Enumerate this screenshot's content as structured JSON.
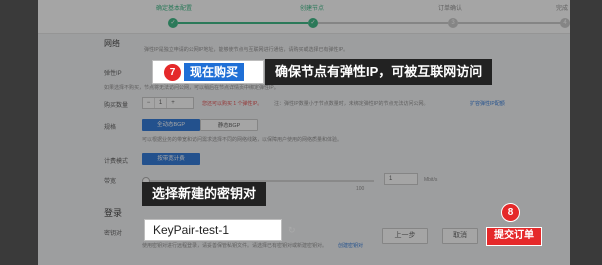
{
  "stepper": {
    "steps": [
      {
        "label": "确定基本配置",
        "state": "done"
      },
      {
        "label": "创建节点",
        "state": "done"
      },
      {
        "label": "订单确认",
        "state": "pending",
        "num": "3"
      },
      {
        "label": "完成",
        "state": "pending",
        "num": "4"
      }
    ]
  },
  "form": {
    "network_label": "网络",
    "network_hint": "弹性IP是独立申请的公网IP地址，能够使节点与互联网进行通信，请购买或选择已有弹性IP。",
    "eip_label": "弹性IP",
    "eip_hint": "如果选择不购买，节点将无法访问公网，可以稍后在节点详情页中绑定弹性IP。",
    "buy_count_label": "购买数量",
    "buy_count_value": "1",
    "buy_count_minus": "−",
    "buy_count_plus": "+",
    "buy_count_hint_red": "您还可以购买 1 个弹性IP。",
    "buy_count_hint": "注：弹性IP数量小于节点数量时，未绑定弹性IP的节点无法访问公网。",
    "buy_count_link": "扩容弹性IP配额",
    "spec_label": "规格",
    "spec_option_1": "全动态BGP",
    "spec_option_2": "静态BGP",
    "spec_hint": "可以根据业务的带宽和访问需求选择不同的网络线路，以保障用户使用的网络质量和体验。",
    "billing_label": "计费模式",
    "billing_option": "按带宽计费",
    "bandwidth_label": "带宽",
    "bandwidth_value": "1",
    "bandwidth_unit": "Mbit/s",
    "bandwidth_max": "100",
    "login_label": "登录",
    "keypair_label": "密钥对",
    "keypair_hint": "使用密钥对进行远程登录，请妥善保管私钥文件。请选择已有密钥对或新建密钥对。",
    "keypair_link": "创建密钥对"
  },
  "callouts": {
    "step7_num": "7",
    "step7_button": "现在购买",
    "step7_text": "确保节点有弹性IP，可被互联网访问",
    "keypair_text": "选择新建的密钥对",
    "keypair_value": "KeyPair-test-1",
    "step8_num": "8",
    "submit_button": "提交订单"
  },
  "footer": {
    "prev": "上一步",
    "cancel": "取消"
  },
  "colors": {
    "accent_green": "#2db37c",
    "accent_blue": "#1f6fd6",
    "accent_red": "#e5292a",
    "callout_bg": "#222222"
  },
  "icons": {
    "refresh": "refresh-icon"
  }
}
